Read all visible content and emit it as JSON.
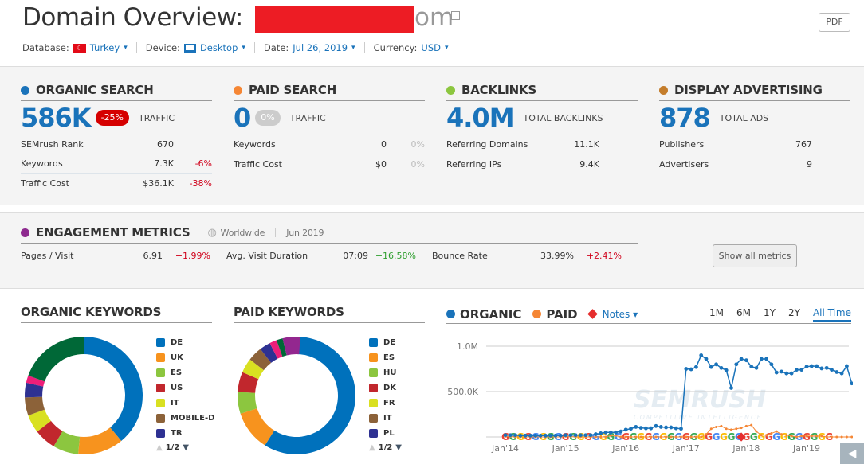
{
  "header": {
    "title": "Domain Overview:",
    "domain_suffix": "om",
    "pdf_label": "PDF",
    "filters": [
      {
        "label": "Database:",
        "value": "Turkey",
        "icon": "turkey-flag-icon"
      },
      {
        "label": "Device:",
        "value": "Desktop",
        "icon": "desktop-icon"
      },
      {
        "label": "Date:",
        "value": "Jul 26, 2019"
      },
      {
        "label": "Currency:",
        "value": "USD"
      }
    ]
  },
  "colors": {
    "accent": "#1a73ba",
    "organic": "#1a73ba",
    "paid": "#f58634",
    "backlinks": "#8cc63f",
    "display": "#c47d2c",
    "engagement": "#8e2a8f",
    "negative": "#d0021b",
    "positive": "#2e9e2e"
  },
  "cards": [
    {
      "title": "ORGANIC SEARCH",
      "value": "586K",
      "badge": "-25%",
      "badge_color": "#d50000",
      "label": "TRAFFIC",
      "rows": [
        {
          "l": "SEMrush Rank",
          "v": "670",
          "c": ""
        },
        {
          "l": "Keywords",
          "v": "7.3K",
          "c": "-6%"
        },
        {
          "l": "Traffic Cost",
          "v": "$36.1K",
          "c": "-38%"
        }
      ]
    },
    {
      "title": "PAID SEARCH",
      "value": "0",
      "badge": "0%",
      "badge_color": "#ccc",
      "label": "TRAFFIC",
      "rows": [
        {
          "l": "Keywords",
          "v": "0",
          "c": "0%"
        },
        {
          "l": "Traffic Cost",
          "v": "$0",
          "c": "0%"
        }
      ]
    },
    {
      "title": "BACKLINKS",
      "value": "4.0M",
      "label": "TOTAL BACKLINKS",
      "rows": [
        {
          "l": "Referring Domains",
          "v": "11.1K",
          "c": ""
        },
        {
          "l": "Referring IPs",
          "v": "9.4K",
          "c": ""
        }
      ]
    },
    {
      "title": "DISPLAY ADVERTISING",
      "value": "878",
      "label": "TOTAL ADS",
      "rows": [
        {
          "l": "Publishers",
          "v": "767",
          "c": ""
        },
        {
          "l": "Advertisers",
          "v": "9",
          "c": ""
        }
      ]
    }
  ],
  "engagement": {
    "title": "ENGAGEMENT METRICS",
    "region": "Worldwide",
    "period": "Jun 2019",
    "show_all": "Show all metrics",
    "metrics": [
      {
        "l": "Pages / Visit",
        "v": "6.91",
        "c": "−1.99%",
        "dir": "neg"
      },
      {
        "l": "Avg. Visit Duration",
        "v": "07:09",
        "c": "+16.58%",
        "dir": "pos"
      },
      {
        "l": "Bounce Rate",
        "v": "33.99%",
        "c": "+2.41%",
        "dir": "neg"
      }
    ]
  },
  "organic_keywords": {
    "title": "ORGANIC KEYWORDS",
    "page": "1/2",
    "slices": [
      {
        "name": "DE",
        "share": 0.39,
        "color": "#0071bc"
      },
      {
        "name": "UK",
        "share": 0.125,
        "color": "#f7931e"
      },
      {
        "name": "ES",
        "share": 0.07,
        "color": "#8cc63f"
      },
      {
        "name": "US",
        "share": 0.06,
        "color": "#c1272d"
      },
      {
        "name": "IT",
        "share": 0.05,
        "color": "#d9e021"
      },
      {
        "name": "MOBILE-D",
        "share": 0.05,
        "color": "#8c6239"
      },
      {
        "name": "TR",
        "share": 0.04,
        "color": "#2e3192"
      },
      {
        "share": 0.02,
        "color": "#ed1e79"
      },
      {
        "share": 0.195,
        "color": "#006837"
      }
    ]
  },
  "paid_keywords": {
    "title": "PAID KEYWORDS",
    "page": "1/2",
    "slices": [
      {
        "name": "DE",
        "share": 0.59,
        "color": "#0071bc"
      },
      {
        "name": "ES",
        "share": 0.11,
        "color": "#f7931e"
      },
      {
        "name": "HU",
        "share": 0.06,
        "color": "#8cc63f"
      },
      {
        "name": "DK",
        "share": 0.055,
        "color": "#c1272d"
      },
      {
        "name": "FR",
        "share": 0.04,
        "color": "#d9e021"
      },
      {
        "name": "IT",
        "share": 0.04,
        "color": "#8c6239"
      },
      {
        "name": "PL",
        "share": 0.03,
        "color": "#2e3192"
      },
      {
        "share": 0.02,
        "color": "#ed1e79"
      },
      {
        "share": 0.017,
        "color": "#006837"
      },
      {
        "share": 0.048,
        "color": "#93278f"
      }
    ]
  },
  "trend": {
    "legend_organic": "ORGANIC",
    "legend_paid": "PAID",
    "notes": "Notes",
    "ranges": [
      "1M",
      "6M",
      "1Y",
      "2Y",
      "All Time"
    ],
    "active_range": "All Time",
    "watermark": "SEMRUSH",
    "watermark_sub": "COMPETITIVE INTELLIGENCE"
  },
  "chart_data": {
    "type": "line",
    "x_start": "2014-01",
    "x_interval": "month",
    "x_ticks": [
      "Jan'14",
      "Jan'15",
      "Jan'16",
      "Jan'17",
      "Jan'18",
      "Jan'19"
    ],
    "y_ticks": [
      "1.0M",
      "500.0K"
    ],
    "ylim": [
      0,
      1000000
    ],
    "series": [
      {
        "name": "ORGANIC",
        "color": "#1a73ba",
        "values": [
          20000,
          20000,
          20000,
          15000,
          15000,
          15000,
          15000,
          15000,
          15000,
          15000,
          15000,
          15000,
          20000,
          20000,
          20000,
          20000,
          20000,
          20000,
          30000,
          40000,
          50000,
          50000,
          50000,
          60000,
          80000,
          90000,
          110000,
          100000,
          95000,
          95000,
          120000,
          110000,
          105000,
          105000,
          95000,
          90000,
          750000,
          745000,
          770000,
          900000,
          860000,
          770000,
          800000,
          760000,
          735000,
          540000,
          800000,
          860000,
          845000,
          775000,
          760000,
          860000,
          860000,
          800000,
          710000,
          720000,
          700000,
          700000,
          740000,
          740000,
          775000,
          780000,
          780000,
          755000,
          760000,
          740000,
          715000,
          700000,
          780000,
          590000
        ]
      },
      {
        "name": "PAID",
        "color": "#f58634",
        "values": [
          5000,
          5000,
          0,
          0,
          0,
          0,
          0,
          0,
          0,
          0,
          0,
          0,
          5000,
          5000,
          0,
          0,
          0,
          0,
          0,
          0,
          0,
          15000,
          15000,
          0,
          0,
          0,
          0,
          0,
          0,
          0,
          0,
          0,
          0,
          0,
          0,
          0,
          0,
          0,
          0,
          0,
          30000,
          90000,
          110000,
          120000,
          90000,
          80000,
          90000,
          100000,
          120000,
          130000,
          60000,
          20000,
          20000,
          40000,
          60000,
          30000,
          20000,
          10000,
          0,
          10000,
          10000,
          10000,
          10000,
          10000,
          0,
          0,
          0,
          0,
          0,
          0
        ]
      }
    ]
  }
}
